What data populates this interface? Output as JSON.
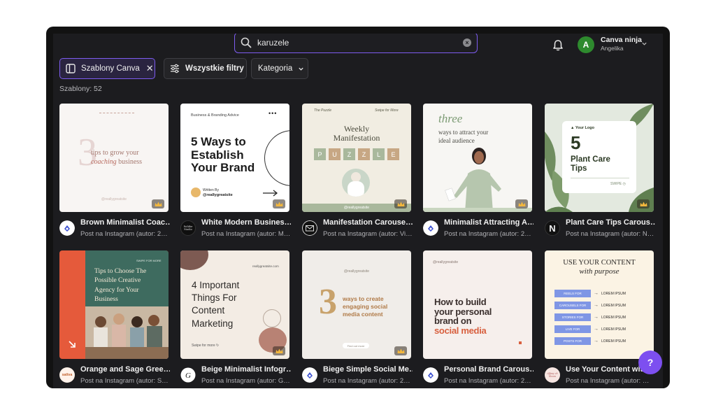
{
  "search": {
    "value": "karuzele",
    "placeholder": ""
  },
  "user": {
    "initial": "A",
    "name": "Canva ninja",
    "subtitle": "Angelika"
  },
  "filters": {
    "canva_chip": "Szablony Canva",
    "all_filters": "Wszystkie filtry",
    "category": "Kategoria"
  },
  "results_count": "Szablony: 52",
  "help_label": "?",
  "accent_color": "#7d5cf0",
  "templates": [
    {
      "title": "Brown Minimalist Coac…",
      "subtitle": "Post na Instagram (autor: 2…",
      "thumb": {
        "big": "3",
        "line1": "tips to grow your",
        "line2a": "coaching",
        "line2b": "business",
        "foot": "@reallygreatsite"
      }
    },
    {
      "title": "White Modern Busines…",
      "subtitle": "Post na Instagram (autor: M…",
      "logo_text": "Soltibe Studio",
      "thumb": {
        "top": "Business & Branding Advice",
        "dots": "•••",
        "l1": "5 Ways to",
        "l2": "Establish",
        "l3": "Your Brand",
        "written": "Written By",
        "handle": "@reallygreatsite"
      }
    },
    {
      "title": "Manifestation Carouse…",
      "subtitle": "Post na Instagram (autor: Vi…",
      "thumb": {
        "top_left": "The Puzzle",
        "top_right": "Swipe for More",
        "l1": "Weekly",
        "l2": "Manifestation",
        "letters": [
          "P",
          "U",
          "Z",
          "Z",
          "L",
          "E"
        ],
        "foot": "@reallygreatsite"
      }
    },
    {
      "title": "Minimalist Attracting A…",
      "subtitle": "Post na Instagram (autor: 2…",
      "thumb": {
        "script": "three",
        "l1": "ways to attract your",
        "l2": "ideal audience"
      }
    },
    {
      "title": "Plant Care Tips Carous…",
      "subtitle": "Post na Instagram (autor: N…",
      "logo_text": "N",
      "thumb": {
        "logo": "Your Logo",
        "big": "5",
        "l1": "Plant Care",
        "l2": "Tips",
        "swipe": "SWIPE"
      }
    },
    {
      "title": "Orange and Sage Gree…",
      "subtitle": "Post na Instagram (autor: S…",
      "logo_text": "sattva",
      "thumb": {
        "top": "SWIPE FOR MORE",
        "l1": "Tips to Choose The",
        "l2": "Possible Creative",
        "l3": "Agency for Your",
        "l4": "Business"
      }
    },
    {
      "title": "Beige Minimalist Infogr…",
      "subtitle": "Post na Instagram (autor: G…",
      "thumb": {
        "site": "reallygreatsite.com",
        "l1": "4 Important",
        "l2": "Things For",
        "l3": "Content",
        "l4": "Marketing",
        "swipe": "Swipe for more"
      }
    },
    {
      "title": "Biege Simple Social Me…",
      "subtitle": "Post na Instagram (autor: 2…",
      "thumb": {
        "top": "@reallygreatsite",
        "big": "3",
        "l1": "ways to create",
        "l2": "engaging social",
        "l3": "media content",
        "btn": "Find out more"
      }
    },
    {
      "title": "Personal Brand Carous…",
      "subtitle": "Post na Instagram (autor: 2…",
      "thumb": {
        "top": "@reallygreatsite",
        "l1": "How to build",
        "l2": "your personal",
        "l3": "brand on",
        "l4": "social media"
      }
    },
    {
      "title": "Use Your Content wit…",
      "subtitle": "Post na Instagram (autor: …",
      "logo_text": "tiffany ch bloom",
      "thumb": {
        "t1": "USE YOUR CONTENT",
        "t2": "with purpose",
        "rows": [
          "REELS FOR",
          "CAROUSELS FOR",
          "STORIES FOR",
          "LIVE FOR",
          "POSTS FOR"
        ],
        "lorem": "LOREM IPSUM"
      }
    }
  ]
}
